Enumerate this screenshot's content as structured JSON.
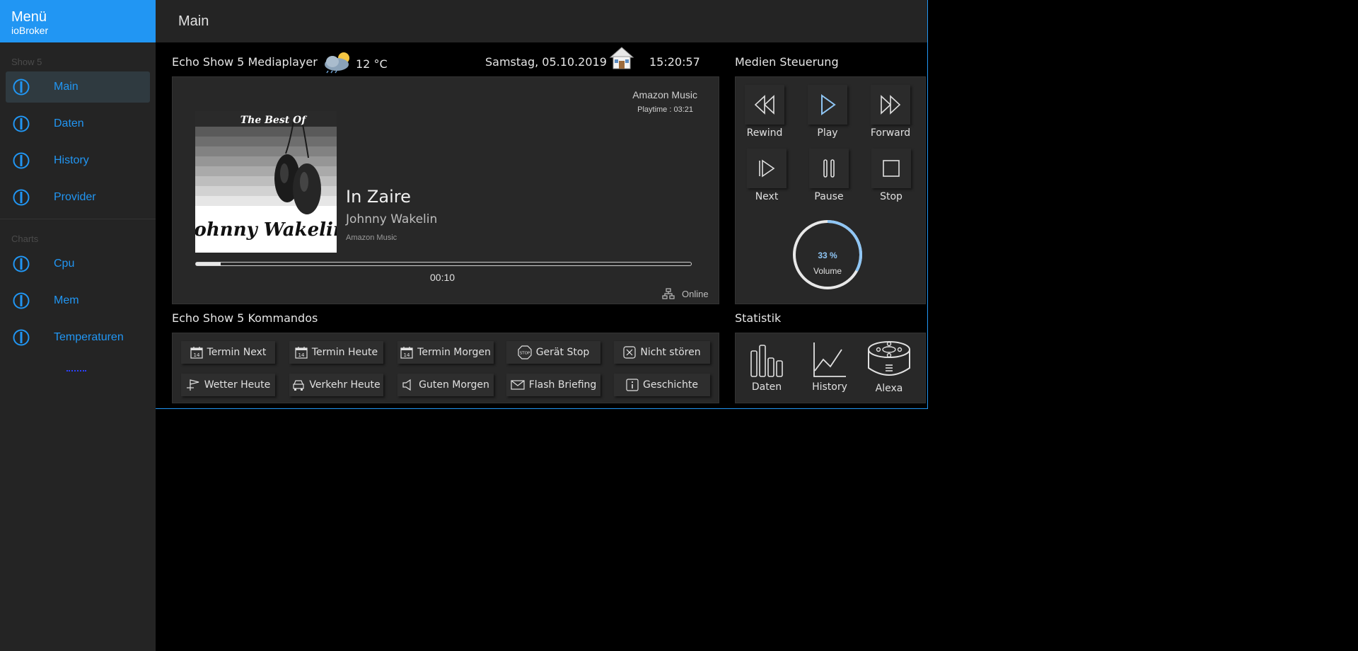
{
  "sidebar": {
    "brand_title": "Menü",
    "brand_subtitle": "ioBroker",
    "section1": "Show 5",
    "section2": "Charts",
    "items": [
      {
        "label": "Main"
      },
      {
        "label": "Daten"
      },
      {
        "label": "History"
      },
      {
        "label": "Provider"
      },
      {
        "label": "Cpu"
      },
      {
        "label": "Mem"
      },
      {
        "label": "Temperaturen"
      }
    ],
    "accent_color": "#2196f3"
  },
  "header": {
    "title": "Main"
  },
  "player": {
    "heading": "Echo Show 5 Mediaplayer",
    "temperature": "12 °C",
    "date": "Samstag, 05.10.2019",
    "time": "15:20:57",
    "source_top": "Amazon Music",
    "playtime": "Playtime : 03:21",
    "album_title": "The Best Of",
    "album_artist": "Johnny Wakelin",
    "song_title": "In Zaire",
    "song_artist": "Johnny Wakelin",
    "song_source": "Amazon Music",
    "elapsed": "00:10",
    "progress_fraction": 0.05,
    "status": "Online"
  },
  "media": {
    "heading": "Medien Steuerung",
    "rewind": "Rewind",
    "play": "Play",
    "forward": "Forward",
    "next": "Next",
    "pause": "Pause",
    "stop": "Stop",
    "volume_value": "33 %",
    "volume_fraction": 0.33,
    "volume_label": "Volume"
  },
  "commands": {
    "heading": "Echo Show 5 Kommandos",
    "termin_next": "Termin Next",
    "termin_heute": "Termin Heute",
    "termin_morgen": "Termin Morgen",
    "geraet_stop": "Gerät Stop",
    "nicht_stoeren": "Nicht stören",
    "wetter_heute": "Wetter Heute",
    "verkehr_heute": "Verkehr Heute",
    "guten_morgen": "Guten Morgen",
    "flash_briefing": "Flash Briefing",
    "geschichte": "Geschichte"
  },
  "stats": {
    "heading": "Statistik",
    "daten": "Daten",
    "history": "History",
    "alexa": "Alexa"
  }
}
